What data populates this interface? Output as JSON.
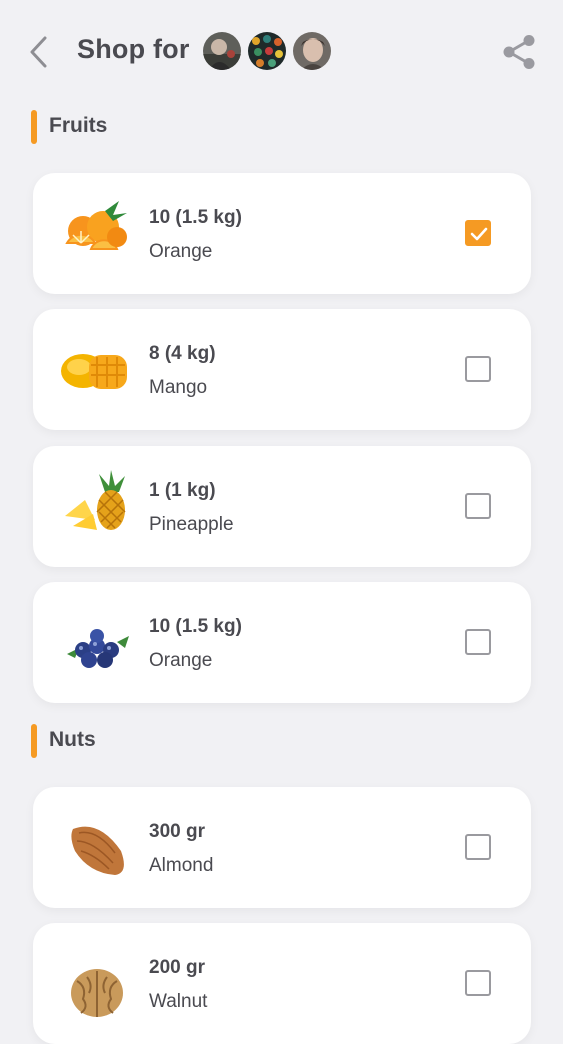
{
  "header": {
    "title": "Shop for",
    "avatars": [
      "avatar-1",
      "avatar-2",
      "avatar-3"
    ]
  },
  "sections": [
    {
      "label": "Fruits",
      "items": [
        {
          "qty": "10 (1.5 kg)",
          "name": "Orange",
          "checked": true,
          "icon": "orange-icon"
        },
        {
          "qty": "8 (4 kg)",
          "name": "Mango",
          "checked": false,
          "icon": "mango-icon"
        },
        {
          "qty": "1 (1 kg)",
          "name": "Pineapple",
          "checked": false,
          "icon": "pineapple-icon"
        },
        {
          "qty": "10 (1.5 kg)",
          "name": "Orange",
          "checked": false,
          "icon": "blueberry-icon"
        }
      ]
    },
    {
      "label": "Nuts",
      "items": [
        {
          "qty": "300 gr",
          "name": "Almond",
          "checked": false,
          "icon": "almond-icon"
        },
        {
          "qty": "200 gr",
          "name": "Walnut",
          "checked": false,
          "icon": "walnut-icon"
        }
      ]
    }
  ],
  "colors": {
    "accent": "#f59a23",
    "background": "#f1f1f4",
    "card": "#ffffff",
    "text": "#4a4a50"
  }
}
